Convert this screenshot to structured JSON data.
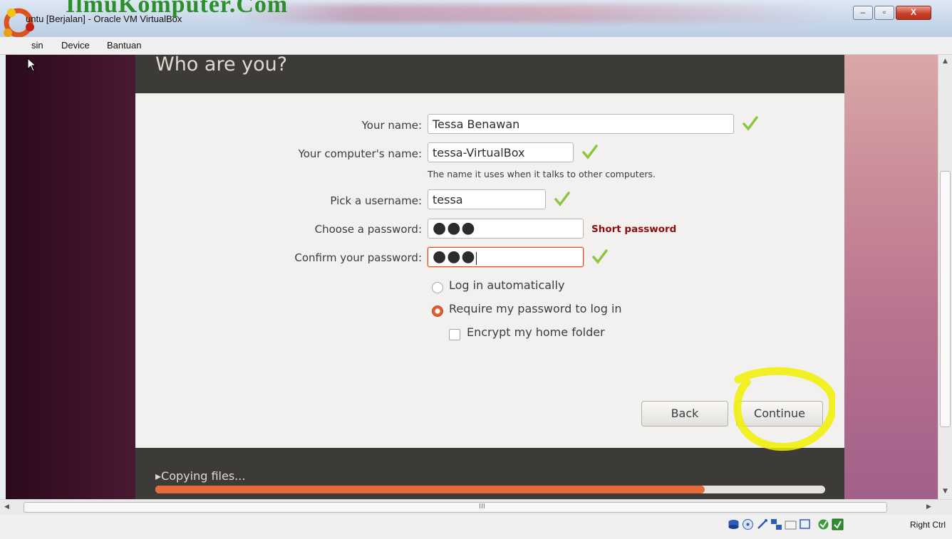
{
  "window": {
    "title": "untu [Berjalan] - Oracle VM VirtualBox",
    "watermark": "IlmuKomputer.Com",
    "controls": {
      "minimize": "–",
      "maximize": "▫",
      "close": "X"
    }
  },
  "menu": {
    "items": [
      "sin",
      "Device",
      "Bantuan"
    ]
  },
  "installer": {
    "title": "Who are you?",
    "fields": {
      "name": {
        "label": "Your name:",
        "value": "Tessa Benawan"
      },
      "computer": {
        "label": "Your computer's name:",
        "value": "tessa-VirtualBox",
        "hint": "The name it uses when it talks to other computers."
      },
      "username": {
        "label": "Pick a username:",
        "value": "tessa"
      },
      "password": {
        "label": "Choose a password:",
        "value": "●●●",
        "warning": "Short password"
      },
      "confirm": {
        "label": "Confirm your password:",
        "value": "●●●"
      }
    },
    "options": {
      "auto_login": "Log in automatically",
      "require_password": "Require my password to log in",
      "encrypt_home": "Encrypt my home folder",
      "selected": "require_password",
      "encrypt_checked": false
    },
    "buttons": {
      "back": "Back",
      "continue": "Continue"
    },
    "footer": {
      "status": "Copying files...",
      "progress": 0.82
    }
  },
  "colors": {
    "accent": "#dd4814",
    "check": "#8cc63f",
    "warning": "#8b0e0e",
    "highlight": "#f0f000"
  },
  "statusbar": {
    "icons": [
      "hard-disk-icon",
      "optical-drive-icon",
      "usb-icon",
      "network-icon",
      "shared-folders-icon",
      "display-icon",
      "capture-icon",
      "keyboard-capture-icon"
    ],
    "host_key": "Right Ctrl"
  },
  "scrollbar": {
    "grip": "III"
  }
}
